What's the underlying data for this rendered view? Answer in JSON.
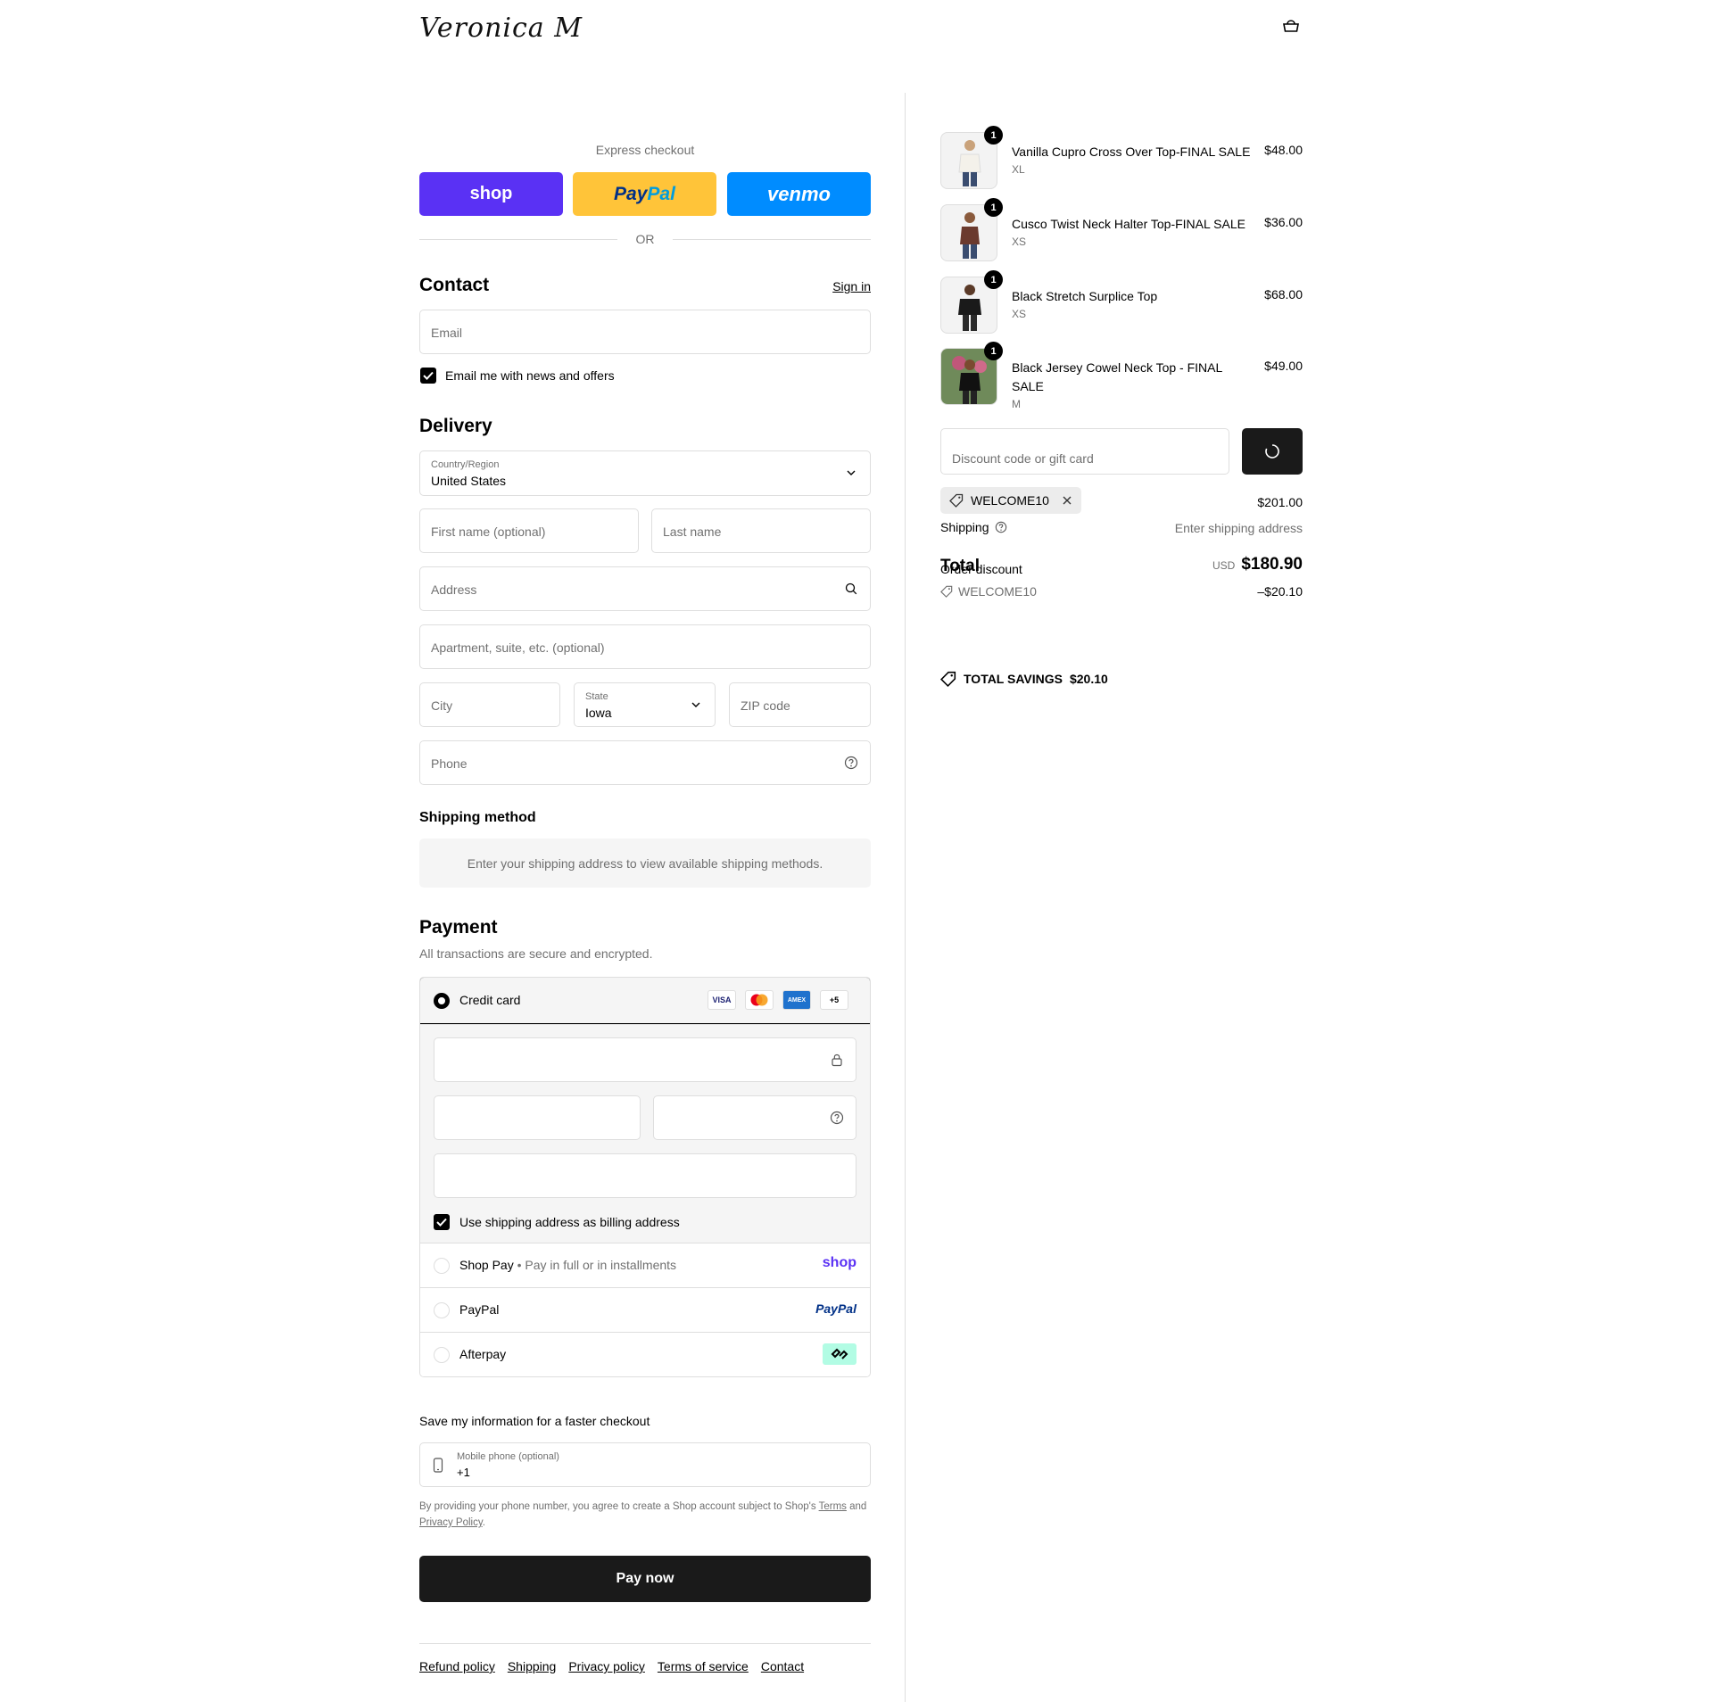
{
  "header": {
    "brand": "Veronica M"
  },
  "express": {
    "label": "Express checkout",
    "shop": "shop",
    "paypal_a": "Pay",
    "paypal_b": "Pal",
    "venmo": "venmo",
    "or": "OR"
  },
  "contact": {
    "title": "Contact",
    "sign_in": "Sign in",
    "email_placeholder": "Email",
    "newsletter": "Email me with news and offers"
  },
  "delivery": {
    "title": "Delivery",
    "country_label": "Country/Region",
    "country_value": "United States",
    "first_name": "First name (optional)",
    "last_name": "Last name",
    "address": "Address",
    "apartment": "Apartment, suite, etc. (optional)",
    "city": "City",
    "state_label": "State",
    "state_value": "Iowa",
    "zip": "ZIP code",
    "phone": "Phone"
  },
  "shipping_method": {
    "title": "Shipping method",
    "message": "Enter your shipping address to view available shipping methods."
  },
  "payment": {
    "title": "Payment",
    "subtitle": "All transactions are secure and encrypted.",
    "credit_card": "Credit card",
    "card_logos": [
      "VISA",
      "AMEX",
      "+5"
    ],
    "billing_same": "Use shipping address as billing address",
    "shop_pay": "Shop Pay",
    "shop_pay_note": "Pay in full or in installments",
    "shop_logo": "shop",
    "paypal": "PayPal",
    "paypal_logo": "PayPal",
    "afterpay": "Afterpay"
  },
  "save_info": {
    "title": "Save my information for a faster checkout",
    "phone_label": "Mobile phone (optional)",
    "phone_value": "+1",
    "legal_1": "By providing your phone number, you agree to create a Shop account subject to Shop's",
    "terms": "Terms",
    "legal_2": "and",
    "privacy": "Privacy Policy",
    "legal_3": "."
  },
  "pay_now": "Pay now",
  "footer": [
    "Refund policy",
    "Shipping",
    "Privacy policy",
    "Terms of service",
    "Contact"
  ],
  "summary": {
    "items": [
      {
        "name": "Vanilla Cupro Cross Over Top-FINAL SALE",
        "variant": "XL",
        "price": "$48.00",
        "qty": "1"
      },
      {
        "name": "Cusco Twist Neck Halter Top-FINAL SALE",
        "variant": "XS",
        "price": "$36.00",
        "qty": "1"
      },
      {
        "name": "Black Stretch Surplice Top",
        "variant": "XS",
        "price": "$68.00",
        "qty": "1"
      },
      {
        "name": "Black Jersey Cowel Neck Top - FINAL SALE",
        "variant": "M",
        "price": "$49.00",
        "qty": "1"
      }
    ],
    "discount_placeholder": "Discount code or gift card",
    "code": "WELCOME10",
    "subtotal": "$201.00",
    "shipping_label": "Shipping",
    "shipping_value": "Enter shipping address",
    "total_label": "Total",
    "currency": "USD",
    "total": "$180.90",
    "order_discount_label": "Order discount",
    "order_discount_code": "WELCOME10",
    "order_discount_value": "–$20.10",
    "savings_label": "TOTAL SAVINGS",
    "savings_value": "$20.10"
  },
  "colors": {
    "shop": "#5a31f4",
    "paypal": "#ffc439",
    "venmo": "#008cff",
    "button": "#1a1a1a",
    "afterpay": "#b2fce4"
  }
}
